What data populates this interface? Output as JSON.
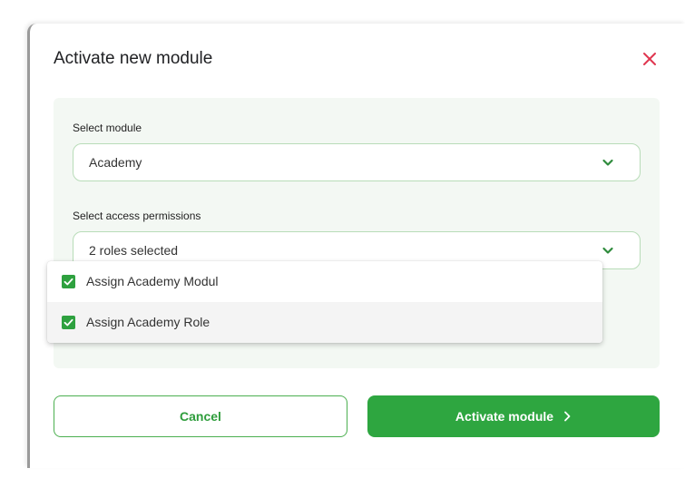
{
  "modal": {
    "title": "Activate new module",
    "close_icon": "close-icon",
    "accent_color": "#2ea640",
    "close_color": "#e0364f"
  },
  "form": {
    "module_label": "Select module",
    "module_value": "Academy",
    "permissions_label": "Select access permissions",
    "permissions_value": "2 roles selected"
  },
  "dropdown": {
    "options": [
      {
        "label": "Assign Academy Modul",
        "checked": true
      },
      {
        "label": "Assign Academy Role",
        "checked": true
      }
    ]
  },
  "buttons": {
    "cancel_label": "Cancel",
    "activate_label": "Activate module"
  }
}
